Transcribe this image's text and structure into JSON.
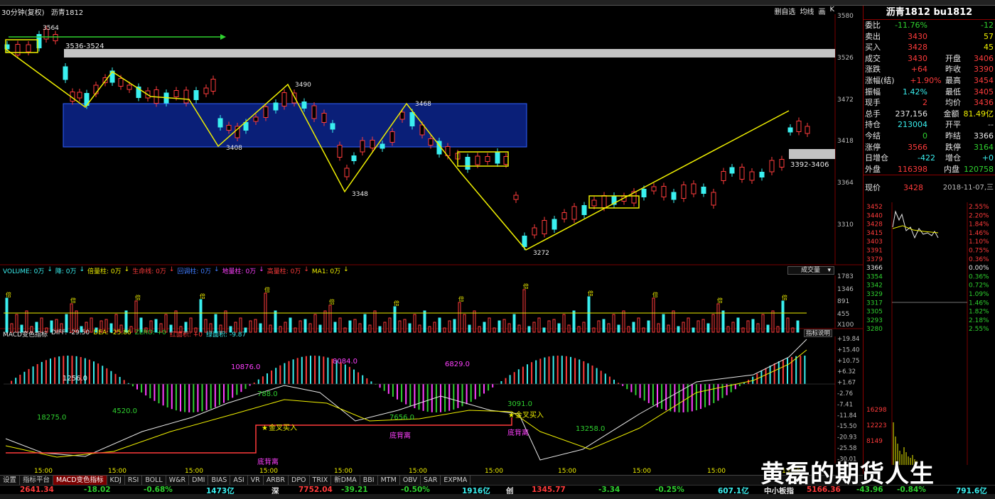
{
  "chart_header": {
    "period": "30分钟(复权)",
    "symbol": "沥青1812",
    "right_labels": [
      "删自选",
      "均线",
      "画",
      "K"
    ]
  },
  "price_axis": [
    "3580",
    "3526",
    "3472",
    "3418",
    "3364",
    "3310"
  ],
  "kline_annotations": {
    "high": "3564",
    "box1": "3536-3524",
    "p3490": "3490",
    "p3408": "3408",
    "p3468": "3468",
    "p3348": "3348",
    "p3272": "3272",
    "box2": "3392-3406"
  },
  "volume": {
    "header": [
      {
        "text": "VOLUME: 0万",
        "color": "#3af0f0"
      },
      {
        "text": "↓",
        "color": "#3af0f0"
      },
      {
        "text": "降: 0万",
        "color": "#3af0f0"
      },
      {
        "text": "↓",
        "color": "#3af0f0"
      },
      {
        "text": "倍量柱: 0万",
        "color": "#f0f000"
      },
      {
        "text": "↓",
        "color": "#f0f000"
      },
      {
        "text": "生命线: 0万",
        "color": "#ff3b3b"
      },
      {
        "text": "↓",
        "color": "#ff3b3b"
      },
      {
        "text": "回调柱: 0万",
        "color": "#3f7cff"
      },
      {
        "text": "↓",
        "color": "#3f7cff"
      },
      {
        "text": "地量柱: 0万",
        "color": "#ff40ff"
      },
      {
        "text": "↓",
        "color": "#ff40ff"
      },
      {
        "text": "高量柱: 0万",
        "color": "#ff3b3b"
      },
      {
        "text": "↓",
        "color": "#ff3b3b"
      },
      {
        "text": "MA1: 0万",
        "color": "#f0f000"
      },
      {
        "text": "↓",
        "color": "#f0f000"
      }
    ],
    "dropdown": "成交量",
    "axis": [
      "1783",
      "1346",
      "891",
      "455",
      "X100"
    ],
    "mark": "倍"
  },
  "macd": {
    "header": [
      {
        "text": "MACD变色指标",
        "color": "#e8e8e8"
      },
      {
        "text": "DIFF: -29.50",
        "color": "#e8e8e8"
      },
      {
        "text": "DEA: -25.86",
        "color": "#f0f000"
      },
      {
        "text": "ZERO: +0",
        "color": "#2fd12f"
      },
      {
        "text": "红面积: +0",
        "color": "#ff3b3b"
      },
      {
        "text": "绿面积: -9.87",
        "color": "#3af0f0"
      }
    ],
    "button": "指标说明",
    "axis": [
      "+19.84",
      "+15.40",
      "+10.75",
      "+6.32",
      "+1.67",
      "-2.76",
      "-7.41",
      "-11.84",
      "-15.50",
      "-20.93",
      "-25.58",
      "-30.01"
    ],
    "area_labels": [
      "1256.0",
      "18275.0",
      "4520.0",
      "10876.0",
      "788.0",
      "8084.0",
      "7656.0",
      "6829.0",
      "3091.0",
      "13258.0"
    ],
    "signals": {
      "buy": "金叉买入",
      "div": "底背离"
    },
    "time_labels": [
      "15:00",
      "15:00",
      "15:00",
      "15:00",
      "15:00",
      "15:00",
      "15:00",
      "15:00",
      "15:00",
      "15:00",
      "15:00"
    ]
  },
  "tabs": [
    "设置",
    "指标平台",
    "MACD变色指标",
    "KDJ",
    "RSI",
    "BOLL",
    "W&R",
    "DMI",
    "BIAS",
    "ASI",
    "VR",
    "ARBR",
    "DPO",
    "TRIX",
    "新DMA",
    "BBI",
    "MTM",
    "OBV",
    "SAR",
    "EXPMA"
  ],
  "active_tab": "MACD变色指标",
  "index_bar": [
    {
      "text": "2641.34",
      "color": "#ff3b3b"
    },
    {
      "text": "-18.02",
      "color": "#2fd12f"
    },
    {
      "text": "-0.68%",
      "color": "#2fd12f"
    },
    {
      "text": "1473亿",
      "color": "#3af0f0"
    },
    {
      "text": "深",
      "color": "#e8e8e8"
    },
    {
      "text": "7752.04",
      "color": "#ff3b3b"
    },
    {
      "text": "-39.21",
      "color": "#2fd12f"
    },
    {
      "text": "-0.50%",
      "color": "#2fd12f"
    },
    {
      "text": "1916亿",
      "color": "#3af0f0"
    },
    {
      "text": "创",
      "color": "#e8e8e8"
    },
    {
      "text": "1345.77",
      "color": "#ff3b3b"
    },
    {
      "text": "-3.34",
      "color": "#2fd12f"
    },
    {
      "text": "-0.25%",
      "color": "#2fd12f"
    },
    {
      "text": "607.1亿",
      "color": "#3af0f0"
    },
    {
      "text": "中小板指",
      "color": "#e8e8e8"
    },
    {
      "text": "5166.36",
      "color": "#ff3b3b"
    },
    {
      "text": "-43.96",
      "color": "#2fd12f"
    },
    {
      "text": "-0.84%",
      "color": "#2fd12f"
    },
    {
      "text": "791.6亿",
      "color": "#3af0f0"
    }
  ],
  "quote": {
    "title": "沥青1812 bu1812",
    "rows": [
      {
        "l1": "委比",
        "v1": "-11.76%",
        "c1": "#2fd12f",
        "l2": "",
        "v2": "-12",
        "c2": "#2fd12f"
      },
      {
        "l1": "卖出",
        "v1": "3430",
        "c1": "#ff3b3b",
        "l2": "",
        "v2": "57",
        "c2": "#f0f000"
      },
      {
        "l1": "买入",
        "v1": "3428",
        "c1": "#ff3b3b",
        "l2": "",
        "v2": "45",
        "c2": "#f0f000"
      },
      {
        "l1": "成交",
        "v1": "3430",
        "c1": "#ff3b3b",
        "l2": "开盘",
        "v2": "3406",
        "c2": "#ff3b3b"
      },
      {
        "l1": "涨跌",
        "v1": "+64",
        "c1": "#ff3b3b",
        "l2": "昨收",
        "v2": "3390",
        "c2": "#ff3b3b"
      },
      {
        "l1": "涨幅(结)",
        "v1": "+1.90%",
        "c1": "#ff3b3b",
        "l2": "最高",
        "v2": "3454",
        "c2": "#ff3b3b"
      },
      {
        "l1": "振幅",
        "v1": "1.42%",
        "c1": "#3af0f0",
        "l2": "最低",
        "v2": "3405",
        "c2": "#ff3b3b"
      },
      {
        "l1": "现手",
        "v1": "2",
        "c1": "#ff3b3b",
        "l2": "均价",
        "v2": "3436",
        "c2": "#ff3b3b"
      },
      {
        "l1": "总手",
        "v1": "237,156",
        "c1": "#e8e8e8",
        "l2": "金额",
        "v2": "81.49亿",
        "c2": "#f0f000"
      },
      {
        "l1": "持仓",
        "v1": "213004",
        "c1": "#3af0f0",
        "l2": "开平",
        "v2": "--",
        "c2": "#bdbdbd"
      },
      {
        "l1": "今结",
        "v1": "0",
        "c1": "#2fd12f",
        "l2": "昨结",
        "v2": "3366",
        "c2": "#e8e8e8"
      },
      {
        "l1": "涨停",
        "v1": "3566",
        "c1": "#ff3b3b",
        "l2": "跌停",
        "v2": "3164",
        "c2": "#2fd12f"
      },
      {
        "l1": "日增仓",
        "v1": "-422",
        "c1": "#3af0f0",
        "l2": "增仓",
        "v2": "+0",
        "c2": "#3af0f0"
      },
      {
        "l1": "外盘",
        "v1": "116398",
        "c1": "#ff3b3b",
        "l2": "内盘",
        "v2": "120758",
        "c2": "#2fd12f"
      }
    ],
    "current_label": "现价",
    "current_value": "3428",
    "date": "2018-11-07,三",
    "mini_left": [
      "3452",
      "3440",
      "3428",
      "3415",
      "3403",
      "3391",
      "3379",
      "3366",
      "3354",
      "3342",
      "3329",
      "3317",
      "3305",
      "3293",
      "3280",
      "16298",
      "12223",
      "8149"
    ],
    "mini_right": [
      "2.55%",
      "2.20%",
      "1.84%",
      "1.46%",
      "1.10%",
      "0.75%",
      "0.36%",
      "0.00%",
      "0.36%",
      "0.72%",
      "1.09%",
      "1.46%",
      "1.82%",
      "2.18%",
      "2.55%"
    ]
  },
  "watermark": "黄磊的期货人生",
  "colors": {
    "up": "#ff3b3b",
    "down": "#3af0f0",
    "box": "#0a1f78",
    "yellow": "#f0f000"
  }
}
